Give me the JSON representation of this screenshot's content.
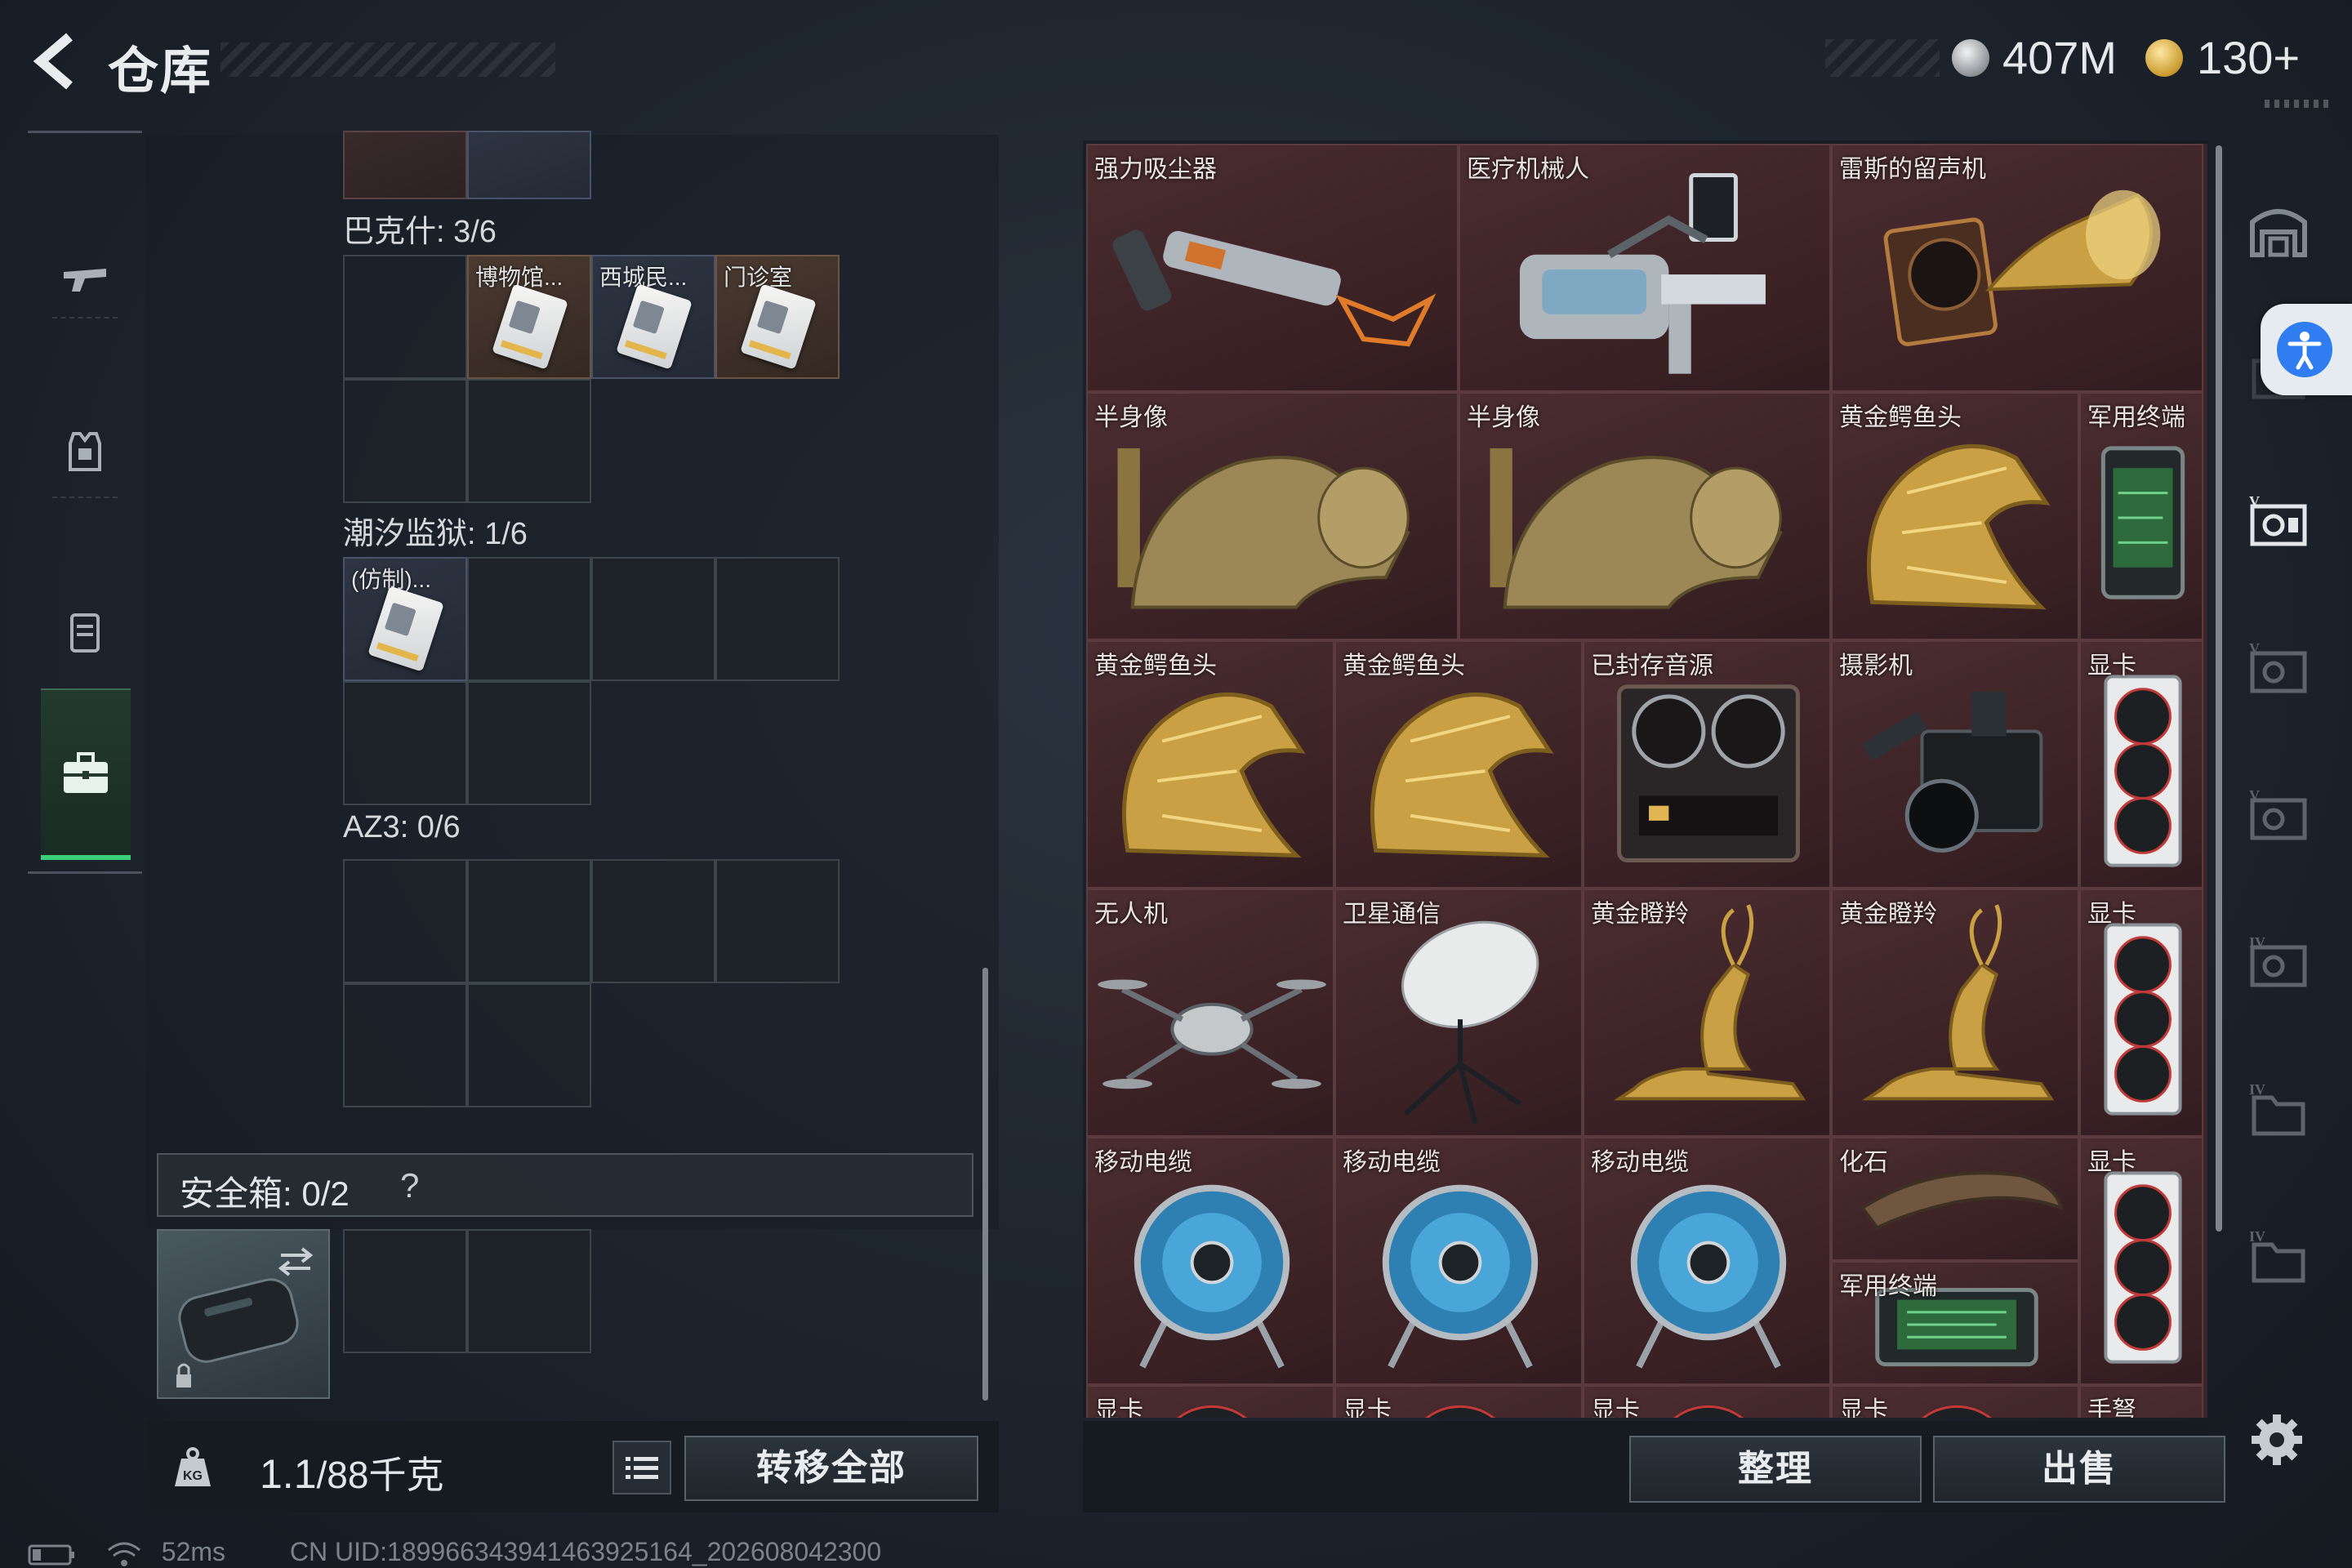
{
  "header": {
    "title": "仓库",
    "currency_silver": "407M",
    "currency_gold": "130+"
  },
  "nav": {
    "items": [
      {
        "name": "weapon",
        "icon": "gun-icon"
      },
      {
        "name": "armor",
        "icon": "vest-icon"
      },
      {
        "name": "backpack",
        "icon": "backpack-icon"
      },
      {
        "name": "keys",
        "icon": "briefcase-icon",
        "active": true
      }
    ]
  },
  "left": {
    "sections": [
      {
        "label": "巴克什: 3/6",
        "cards": [
          "博物馆...",
          "西城民...",
          "门诊室"
        ]
      },
      {
        "label": "潮汐监狱: 1/6",
        "cards": [
          "(仿制)..."
        ]
      },
      {
        "label": "AZ3: 0/6",
        "cards": []
      }
    ],
    "safe_box": {
      "title": "安全箱: 0/2",
      "help": "?"
    },
    "weight": {
      "current": "1.1",
      "max": "/88千克"
    },
    "transfer_all": "转移全部"
  },
  "stash": {
    "items": [
      {
        "label": "强力吸尘器",
        "icon": "vacuum-icon"
      },
      {
        "label": "医疗机械人",
        "icon": "medical-robot-icon"
      },
      {
        "label": "雷斯的留声机",
        "icon": "gramophone-icon"
      },
      {
        "label": "半身像",
        "icon": "bust-icon"
      },
      {
        "label": "半身像",
        "icon": "bust-icon"
      },
      {
        "label": "黄金鳄鱼头",
        "icon": "gold-croc-head-icon"
      },
      {
        "label": "军用终端",
        "icon": "military-terminal-icon"
      },
      {
        "label": "黄金鳄鱼头",
        "icon": "gold-croc-head-icon"
      },
      {
        "label": "黄金鳄鱼头",
        "icon": "gold-croc-head-icon"
      },
      {
        "label": "已封存音源",
        "icon": "reel-recorder-icon"
      },
      {
        "label": "摄影机",
        "icon": "camera-icon"
      },
      {
        "label": "显卡",
        "icon": "gpu-icon"
      },
      {
        "label": "无人机",
        "icon": "drone-icon"
      },
      {
        "label": "卫星通信",
        "icon": "satellite-dish-icon"
      },
      {
        "label": "黄金瞪羚",
        "icon": "gold-gazelle-icon"
      },
      {
        "label": "黄金瞪羚",
        "icon": "gold-gazelle-icon"
      },
      {
        "label": "显卡",
        "icon": "gpu-icon"
      },
      {
        "label": "移动电缆",
        "icon": "cable-reel-icon"
      },
      {
        "label": "移动电缆",
        "icon": "cable-reel-icon"
      },
      {
        "label": "移动电缆",
        "icon": "cable-reel-icon"
      },
      {
        "label": "化石",
        "icon": "fossil-icon"
      },
      {
        "label": "显卡",
        "icon": "gpu-icon"
      },
      {
        "label": "军用终端",
        "icon": "military-terminal-icon"
      },
      {
        "label": "显卡",
        "icon": "gpu-icon"
      },
      {
        "label": "显卡",
        "icon": "gpu-icon"
      },
      {
        "label": "显卡",
        "icon": "gpu-icon"
      },
      {
        "label": "显卡",
        "icon": "gpu-icon"
      },
      {
        "label": "手弩",
        "icon": "crossbow-icon"
      }
    ],
    "organize": "整理",
    "sell": "出售"
  },
  "status": {
    "ping": "52ms",
    "uid": "CN UID:1899663439414639251​64_202608042300"
  },
  "colors": {
    "accent_green": "#3bcf7a",
    "stash_bg": "#3d2326",
    "accessibility_blue": "#2f7df0"
  }
}
